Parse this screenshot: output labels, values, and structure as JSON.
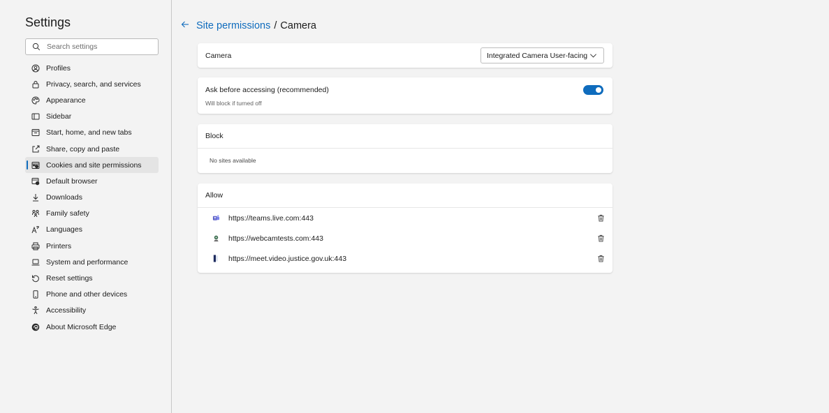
{
  "sidebar": {
    "title": "Settings",
    "search_placeholder": "Search settings",
    "items": [
      {
        "label": "Profiles",
        "icon": "profile-icon"
      },
      {
        "label": "Privacy, search, and services",
        "icon": "lock-icon"
      },
      {
        "label": "Appearance",
        "icon": "appearance-icon"
      },
      {
        "label": "Sidebar",
        "icon": "sidebar-icon"
      },
      {
        "label": "Start, home, and new tabs",
        "icon": "home-tabs-icon"
      },
      {
        "label": "Share, copy and paste",
        "icon": "share-icon"
      },
      {
        "label": "Cookies and site permissions",
        "icon": "cookies-icon"
      },
      {
        "label": "Default browser",
        "icon": "default-browser-icon"
      },
      {
        "label": "Downloads",
        "icon": "download-icon"
      },
      {
        "label": "Family safety",
        "icon": "family-icon"
      },
      {
        "label": "Languages",
        "icon": "languages-icon"
      },
      {
        "label": "Printers",
        "icon": "printer-icon"
      },
      {
        "label": "System and performance",
        "icon": "laptop-icon"
      },
      {
        "label": "Reset settings",
        "icon": "reset-icon"
      },
      {
        "label": "Phone and other devices",
        "icon": "phone-icon"
      },
      {
        "label": "Accessibility",
        "icon": "accessibility-icon"
      },
      {
        "label": "About Microsoft Edge",
        "icon": "edge-icon"
      }
    ],
    "active_item": "Cookies and site permissions"
  },
  "header": {
    "breadcrumb_link": "Site permissions",
    "separator": "/",
    "current": "Camera"
  },
  "camera": {
    "label": "Camera",
    "selected_device": "Integrated Camera User-facing"
  },
  "ask": {
    "title": "Ask before accessing (recommended)",
    "subtitle": "Will block if turned off",
    "enabled": true
  },
  "block": {
    "title": "Block",
    "empty_text": "No sites available"
  },
  "allow": {
    "title": "Allow",
    "sites": [
      {
        "url": "https://teams.live.com:443",
        "icon": "teams-icon"
      },
      {
        "url": "https://webcamtests.com:443",
        "icon": "webcam-icon"
      },
      {
        "url": "https://meet.video.justice.gov.uk:443",
        "icon": "justice-icon"
      }
    ]
  },
  "colors": {
    "accent": "#0f6cbd",
    "background": "#f3f3f3",
    "card": "#ffffff"
  }
}
